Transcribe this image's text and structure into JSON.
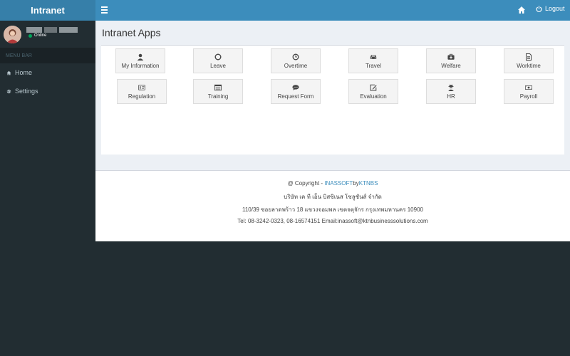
{
  "header": {
    "brand": "Intranet",
    "logout_label": "Logout"
  },
  "sidebar": {
    "user_status": "Online",
    "menu_header": "MENU BAR",
    "items": [
      {
        "label": "Home",
        "icon": "home-icon"
      },
      {
        "label": "Settings",
        "icon": "gear-icon"
      }
    ]
  },
  "main": {
    "title": "Intranet Apps",
    "apps": [
      {
        "label": "My Information",
        "icon": "user-icon"
      },
      {
        "label": "Leave",
        "icon": "circle-icon"
      },
      {
        "label": "Overtime",
        "icon": "clock-icon"
      },
      {
        "label": "Travel",
        "icon": "car-icon"
      },
      {
        "label": "Welfare",
        "icon": "medkit-icon"
      },
      {
        "label": "Worktime",
        "icon": "file-icon"
      },
      {
        "label": "Regulation",
        "icon": "id-card-icon"
      },
      {
        "label": "Training",
        "icon": "calendar-icon"
      },
      {
        "label": "Request Form",
        "icon": "comment-icon"
      },
      {
        "label": "Evaluation",
        "icon": "edit-icon"
      },
      {
        "label": "HR",
        "icon": "user-secret-icon"
      },
      {
        "label": "Payroll",
        "icon": "money-icon"
      }
    ]
  },
  "footer": {
    "copyright_prefix": "@ Copyright - ",
    "link1": "INASSOFT",
    "by": "by",
    "link2": "KTNBS",
    "company": "บริษัท เค ที เอ็น บิสซิเนส โซลูชันส์ จำกัด",
    "address": "110/39 ซอยลาดพร้าว 18 แขวงจอมพล เขตจตุจักร กรุงเทพมหานคร 10900",
    "contact": "Tel: 08-3242-0323, 08-16574151 Email:inassoft@ktnbusinesssolutions.com"
  },
  "colors": {
    "header_bar": "#3c8dbc",
    "logo_bg": "#367fa9",
    "sidebar_bg": "#222d32",
    "online": "#00a65a"
  }
}
